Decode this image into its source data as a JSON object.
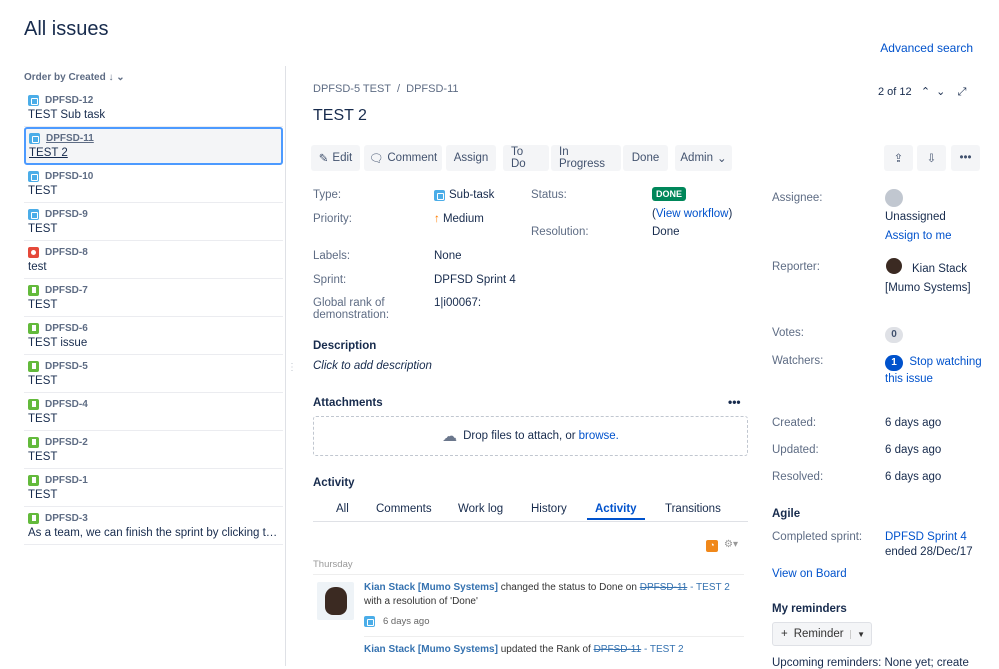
{
  "page": {
    "title": "All issues",
    "advanced_search": "Advanced search"
  },
  "list": {
    "order_label": "Order by Created",
    "items": [
      {
        "key": "DPFSD-12",
        "summary": "TEST Sub task",
        "type": "subtask"
      },
      {
        "key": "DPFSD-11",
        "summary": "TEST 2",
        "type": "subtask"
      },
      {
        "key": "DPFSD-10",
        "summary": "TEST",
        "type": "subtask"
      },
      {
        "key": "DPFSD-9",
        "summary": "TEST",
        "type": "subtask"
      },
      {
        "key": "DPFSD-8",
        "summary": "test",
        "type": "bug"
      },
      {
        "key": "DPFSD-7",
        "summary": "TEST",
        "type": "story"
      },
      {
        "key": "DPFSD-6",
        "summary": "TEST issue",
        "type": "story"
      },
      {
        "key": "DPFSD-5",
        "summary": "TEST",
        "type": "story"
      },
      {
        "key": "DPFSD-4",
        "summary": "TEST",
        "type": "story"
      },
      {
        "key": "DPFSD-2",
        "summary": "TEST",
        "type": "story"
      },
      {
        "key": "DPFSD-1",
        "summary": "TEST",
        "type": "story"
      },
      {
        "key": "DPFSD-3",
        "summary": "As a team, we can finish the sprint by clicking the cog icon",
        "type": "story"
      }
    ]
  },
  "issue": {
    "parent": "DPFSD-5 TEST",
    "sep": "/",
    "key": "DPFSD-11",
    "title": "TEST 2",
    "pager": "2 of 12"
  },
  "toolbar": {
    "edit": "Edit",
    "comment": "Comment",
    "assign": "Assign",
    "todo": "To Do",
    "in_progress": "In Progress",
    "done": "Done",
    "admin": "Admin"
  },
  "details": {
    "type_label": "Type:",
    "type": "Sub-task",
    "priority_label": "Priority:",
    "priority": "Medium",
    "status_label": "Status:",
    "status": "DONE",
    "view_workflow": "View workflow",
    "resolution_label": "Resolution:",
    "resolution": "Done",
    "labels_label": "Labels:",
    "labels": "None",
    "sprint_label": "Sprint:",
    "sprint": "DPFSD Sprint 4",
    "rank_label": "Global rank of demonstration:",
    "rank": "1|i00067:"
  },
  "description": {
    "heading": "Description",
    "placeholder": "Click to add description"
  },
  "attachments": {
    "heading": "Attachments",
    "drop": "Drop files to attach, or",
    "browse": "browse."
  },
  "activity": {
    "heading": "Activity",
    "tabs": [
      "All",
      "Comments",
      "Work log",
      "History",
      "Activity",
      "Transitions"
    ],
    "day": "Thursday",
    "entries": [
      {
        "user": "Kian Stack [Mumo Systems]",
        "text": "changed the status to Done on",
        "issue_key": "DPFSD-11",
        "issue_title": "- TEST 2",
        "tail": "with a resolution of 'Done'",
        "time": "6 days ago"
      },
      {
        "user": "Kian Stack [Mumo Systems]",
        "text": "updated the Rank of",
        "issue_key": "DPFSD-11",
        "issue_title": "- TEST 2"
      }
    ]
  },
  "people": {
    "assignee_label": "Assignee:",
    "assignee": "Unassigned",
    "assign_to_me": "Assign to me",
    "reporter_label": "Reporter:",
    "reporter": "Kian Stack [Mumo Systems]",
    "votes_label": "Votes:",
    "votes": "0",
    "watchers_label": "Watchers:",
    "watchers": "1",
    "stop_watching": "Stop watching this issue"
  },
  "dates": {
    "created_label": "Created:",
    "created": "6 days ago",
    "updated_label": "Updated:",
    "updated": "6 days ago",
    "resolved_label": "Resolved:",
    "resolved": "6 days ago"
  },
  "agile": {
    "heading": "Agile",
    "completed_label": "Completed sprint:",
    "sprint": "DPFSD Sprint 4",
    "ended": "ended 28/Dec/17",
    "view_on_board": "View on Board"
  },
  "reminders": {
    "heading": "My reminders",
    "button": "Reminder",
    "upcoming": "Upcoming reminders: None yet; create"
  }
}
